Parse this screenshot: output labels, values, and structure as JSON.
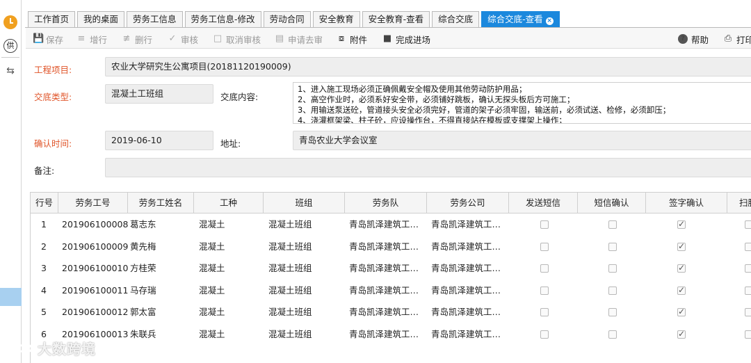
{
  "rail": {
    "supply_label": "供"
  },
  "tabs": [
    {
      "label": "工作首页"
    },
    {
      "label": "我的桌面"
    },
    {
      "label": "劳务工信息"
    },
    {
      "label": "劳务工信息-修改"
    },
    {
      "label": "劳动合同"
    },
    {
      "label": "安全教育"
    },
    {
      "label": "安全教育-查看"
    },
    {
      "label": "综合交底"
    },
    {
      "label": "综合交底-查看",
      "active": true
    }
  ],
  "toolbar": {
    "save": "保存",
    "add_row": "增行",
    "delete_row": "删行",
    "approve": "审核",
    "cancel_approve": "取消审核",
    "request_leave": "申请去审",
    "attachment": "附件",
    "complete_entry": "完成进场",
    "help": "帮助",
    "print": "打印"
  },
  "form": {
    "project_label": "工程项目:",
    "project_value": "农业大学研究生公寓项目(20181120190009)",
    "type_label": "交底类型:",
    "type_value": "混凝土工班组",
    "content_label": "交底内容:",
    "content_lines": [
      "1、进入施工现场必须正确佩戴安全帽及使用其他劳动防护用品；",
      "2、高空作业时，必须系好安全带，必须铺好跳板，确认无探头板后方可施工；",
      "3、用输送泵送砼，管道接头安全必须完好，管道的架子必须牢固，输送前，必须试送、检修，必须卸压；",
      "4、浇灌框架梁、柱子砼，应设操作台，不得直接站在模板或支撑架上操作；"
    ],
    "confirm_time_label": "确认时间:",
    "confirm_time_value": "2019-06-10",
    "address_label": "地址:",
    "address_value": "青岛农业大学会议室",
    "remark_label": "备注:",
    "remark_value": ""
  },
  "grid": {
    "columns": [
      "行号",
      "劳务工号",
      "劳务工姓名",
      "工种",
      "班组",
      "劳务队",
      "劳务公司",
      "发送短信",
      "短信确认",
      "签字确认",
      "扫脸"
    ],
    "rows": [
      {
        "no": "1",
        "id": "201906100008",
        "name": "葛志东",
        "trade": "混凝土",
        "team": "混凝土班组",
        "crew": "青岛凯泽建筑工程…",
        "company": "青岛凯泽建筑工程…",
        "sms": false,
        "sms_confirm": false,
        "sign": true,
        "face": false
      },
      {
        "no": "2",
        "id": "201906100009",
        "name": "黄先梅",
        "trade": "混凝土",
        "team": "混凝土班组",
        "crew": "青岛凯泽建筑工程…",
        "company": "青岛凯泽建筑工程…",
        "sms": false,
        "sms_confirm": false,
        "sign": true,
        "face": false
      },
      {
        "no": "3",
        "id": "201906100010",
        "name": "方桂荣",
        "trade": "混凝土",
        "team": "混凝土班组",
        "crew": "青岛凯泽建筑工程…",
        "company": "青岛凯泽建筑工程…",
        "sms": false,
        "sms_confirm": false,
        "sign": true,
        "face": false
      },
      {
        "no": "4",
        "id": "201906100011",
        "name": "马存瑞",
        "trade": "混凝土",
        "team": "混凝土班组",
        "crew": "青岛凯泽建筑工程…",
        "company": "青岛凯泽建筑工程…",
        "sms": false,
        "sms_confirm": false,
        "sign": true,
        "face": false
      },
      {
        "no": "5",
        "id": "201906100012",
        "name": "郭太富",
        "trade": "混凝土",
        "team": "混凝土班组",
        "crew": "青岛凯泽建筑工程…",
        "company": "青岛凯泽建筑工程…",
        "sms": false,
        "sms_confirm": false,
        "sign": true,
        "face": false
      },
      {
        "no": "6",
        "id": "201906100013",
        "name": "朱联兵",
        "trade": "混凝土",
        "team": "混凝土班组",
        "crew": "青岛凯泽建筑工程…",
        "company": "青岛凯泽建筑工程…",
        "sms": false,
        "sms_confirm": false,
        "sign": true,
        "face": false
      }
    ]
  },
  "watermark": {
    "text": "大数跨境"
  },
  "colors": {
    "accent": "#1b88dd",
    "required_label": "#e0552a"
  }
}
